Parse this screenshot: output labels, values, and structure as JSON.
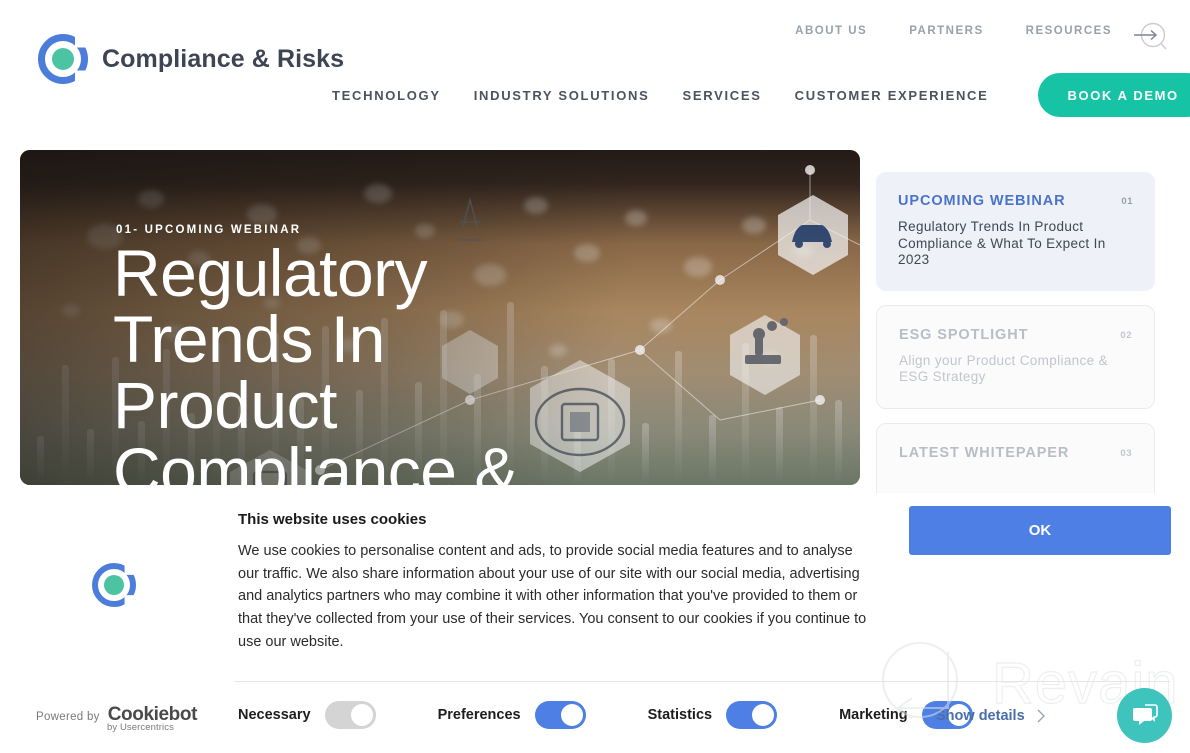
{
  "header": {
    "brand_name": "Compliance & Risks",
    "logo_icon": "compliance-risks-logo",
    "search_icon": "search-arrow-icon",
    "top_nav": [
      {
        "label": "ABOUT US"
      },
      {
        "label": "PARTNERS"
      },
      {
        "label": "RESOURCES"
      }
    ],
    "main_nav": [
      {
        "label": "TECHNOLOGY"
      },
      {
        "label": "INDUSTRY SOLUTIONS"
      },
      {
        "label": "SERVICES"
      },
      {
        "label": "CUSTOMER EXPERIENCE"
      }
    ],
    "demo_button": "BOOK A DEMO"
  },
  "hero": {
    "eyebrow": "01- UPCOMING WEBINAR",
    "title": "Regulatory Trends In Product Compliance &",
    "image_icons": [
      "car-hexagon-icon",
      "robot-arm-hexagon-icon",
      "ai-brain-chip-hexagon-icon",
      "power-tower-hexagon-icon",
      "tablet-hexagon-icon"
    ]
  },
  "side_cards": [
    {
      "kicker": "UPCOMING WEBINAR",
      "number": "01",
      "description": "Regulatory Trends In Product Compliance & What To Expect In 2023",
      "state": "active"
    },
    {
      "kicker": "ESG SPOTLIGHT",
      "number": "02",
      "description": "Align your Product Compliance & ESG Strategy",
      "state": "muted"
    },
    {
      "kicker": "LATEST WHITEPAPER",
      "number": "03",
      "description": "",
      "state": "muted"
    }
  ],
  "cookie_banner": {
    "logo_icon": "compliance-risks-logo",
    "title": "This website uses cookies",
    "body": "We use cookies to personalise content and ads, to provide social media features and to analyse our traffic. We also share information about your use of our site with our social media, advertising and analytics partners who may combine it with other information that you've provided to them or that they've collected from your use of their services. You consent to our cookies if you continue to use our website.",
    "ok_button": "OK",
    "show_details": "Show details",
    "show_details_icon": "chevron-right-icon",
    "consent_categories": [
      {
        "label": "Necessary",
        "enabled": true,
        "locked": true
      },
      {
        "label": "Preferences",
        "enabled": true,
        "locked": false
      },
      {
        "label": "Statistics",
        "enabled": true,
        "locked": false
      },
      {
        "label": "Marketing",
        "enabled": true,
        "locked": false
      }
    ],
    "powered_by_label": "Powered by",
    "powered_by_brand": "Cookiebot",
    "powered_by_sub": "by Usercentrics"
  },
  "watermark": {
    "text": "Revain",
    "icon": "revain-magnifier-icon"
  },
  "chat": {
    "icon": "chat-bubble-icon"
  },
  "colors": {
    "brand_blue": "#4c7ddb",
    "brand_green": "#4cc4a4",
    "demo_teal": "#16c4a5",
    "consent_blue": "#4d7fe4",
    "chat_teal": "#3fc3bd",
    "card_active_bg": "#eef1f7"
  }
}
